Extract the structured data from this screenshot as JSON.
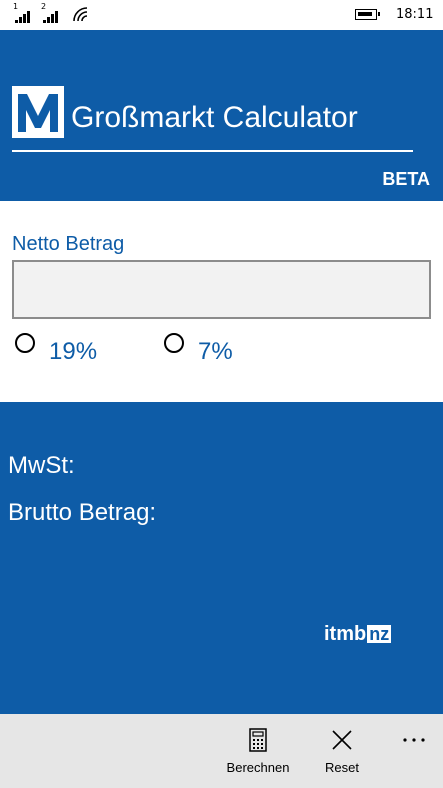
{
  "status_bar": {
    "sim1": "1",
    "sim2": "2",
    "time": "18:11"
  },
  "header": {
    "logo_icon": "metro-m-logo",
    "title": "Großmarkt Calculator",
    "badge": "BETA"
  },
  "form": {
    "netto_label": "Netto Betrag",
    "netto_value": "",
    "vat_options": [
      {
        "label": "19%",
        "selected": false
      },
      {
        "label": "7%",
        "selected": false
      }
    ]
  },
  "results": {
    "mwst_label": "MwSt:",
    "brutto_label": "Brutto Betrag:"
  },
  "brand": {
    "prefix": "itmb",
    "suffix": "nz"
  },
  "app_bar": {
    "calculate": {
      "label": "Berechnen",
      "icon": "calculator-icon"
    },
    "reset": {
      "label": "Reset",
      "icon": "close-icon"
    },
    "more_icon": "more-dots-icon"
  },
  "colors": {
    "accent": "#0e5ca7",
    "app_bar_bg": "#e6e6e6",
    "input_bg": "#f2f2f2"
  }
}
